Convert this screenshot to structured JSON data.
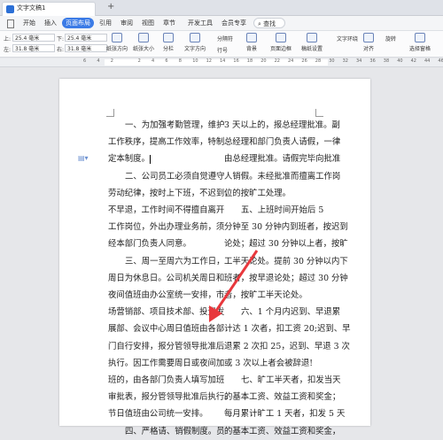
{
  "titlebar": {
    "doc_title": "文字文稿1",
    "new_tab": "+"
  },
  "menu": {
    "items": [
      "开始",
      "插入",
      "页面布局",
      "引用",
      "审阅",
      "视图",
      "章节",
      "开发工具",
      "会员专享"
    ],
    "active": "页面布局",
    "search": "查找"
  },
  "ribbon": {
    "top_label": "上:",
    "top_value": "25.4 毫米",
    "bottom_label": "下:",
    "bottom_value": "25.4 毫米",
    "left_label": "左:",
    "left_value": "31.8 毫米",
    "right_label": "右:",
    "right_value": "31.8 毫米",
    "buttons": [
      "纸张方向",
      "纸张大小",
      "分栏",
      "文字方向",
      "行号",
      "背景",
      "页面边框",
      "稿纸设置",
      "对齐",
      "选择窗格"
    ],
    "small": [
      "分隔符",
      "行号",
      "文字环绕",
      "旋转",
      "组合"
    ]
  },
  "ruler": {
    "nums": [
      "6",
      "4",
      "2",
      "",
      "2",
      "4",
      "6",
      "8",
      "10",
      "12",
      "14",
      "16",
      "18",
      "20",
      "22",
      "24",
      "26",
      "28",
      "30",
      "32",
      "34",
      "36",
      "38",
      "40",
      "42",
      "44",
      "46"
    ]
  },
  "doc": {
    "left_col": [
      "一、为加强考勤管理，维护",
      "工作秩序，提高工作效率，特制",
      "定本制度。",
      "二、公司员工必须自觉遵守",
      "劳动纪律，按时上下班，不迟到，",
      "不早退，工作时间不得擅自离开",
      "工作岗位，外出办理业务前，须",
      "经本部门负责人同意。",
      "三、周一至周六为工作日，",
      "周日为休息日。公司机关周日和",
      "夜间值班由办公室统一安排，市",
      "场营销部、项目技术部、投资发",
      "展部、会议中心周日值班由各部",
      "门自行安排，报分管领导批准后",
      "执行。因工作需要周日或夜间加",
      "班的，由各部门负责人填写加班",
      "审批表，报分管领导批准后执行。",
      "节日值班由公司统一安排。",
      "四、严格请、销假制度。员"
    ],
    "right_col": [
      "3 天以上的，报总经理批准。副",
      "总经理和部门负责人请假，一律",
      "由总经理批准。请假完毕向批准",
      "人销假。未经批准而擅离工作岗",
      "位的按旷工处理。",
      "五、上班时间开始后 5",
      "分钟至 30 分钟内到班者，按迟到",
      "论处；超过 30 分钟以上者，按旷",
      "工半天论处。提前 30 分钟以内下",
      "班者，按早退论处；超过 30 分钟",
      "者，按旷工半天论处。",
      "六、1 个月内迟到、早退累",
      "计达 1 次者，扣工资 20;迟到、早",
      "退累 2 次扣 25，迟到、早退 3 次",
      "或 3 次以上者会被辞退!",
      "七、旷工半天者，扣发当天",
      "的基本工资、效益工资和奖金；",
      "每月累计旷工 1 天者，扣发 5 天",
      "的基本工资、效益工资和奖金，"
    ]
  },
  "colors": {
    "accent": "#3b7be6",
    "arrow": "#e8383d"
  }
}
